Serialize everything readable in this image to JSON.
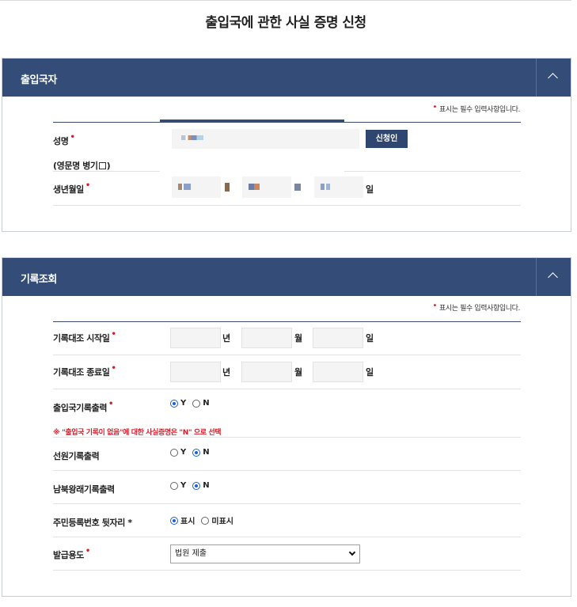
{
  "page_title": "출입국에 관한 사실 증명 신청",
  "required_note": "표시는 필수 입력사항입니다.",
  "section1": {
    "title": "출입국자",
    "name_label": "성명",
    "english_name_label_open": "(영문명 병기",
    "english_name_label_close": ")",
    "apply_button": "신청인",
    "birth_label": "생년월일",
    "day_unit": "일"
  },
  "section2": {
    "title": "기록조회",
    "start_label": "기록대조 시작일",
    "end_label": "기록대조 종료일",
    "unit_year": "년",
    "unit_month": "월",
    "unit_day": "일",
    "immigration_label": "출입국기록출력",
    "notice": "※ \"출입국 기록이 없음\"에 대한 사실증명은 \"N\" 으로 선택",
    "seaman_label": "선원기록출력",
    "nk_label": "남북왕래기록출력",
    "rrn_label": "주민등록번호 뒷자리 *",
    "purpose_label": "발급용도",
    "purpose_value": "법원 제출",
    "opt_y": "Y",
    "opt_n": "N",
    "opt_show": "표시",
    "opt_hide": "미표시"
  },
  "colors": {
    "header_bg": "#344c78",
    "accent_red": "#d61e2b",
    "radio_blue": "#1f5fd1"
  }
}
